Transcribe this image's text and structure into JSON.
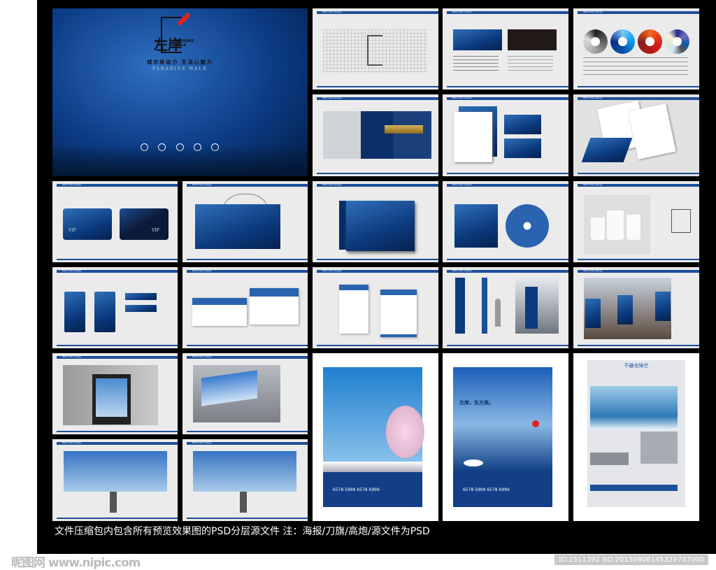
{
  "cover": {
    "logo_cn": "左岸",
    "logo_en_1": "PARADISE",
    "logo_en_2": "WALK",
    "slogan": "城市核动力  生活心魅力",
    "subtitle": "PARADISE WALK"
  },
  "page_header": "HEZ Urban Design",
  "cards": {
    "vip": "VIP"
  },
  "posters": [
    {
      "phone": "6578 5999  6578 6999"
    },
    {
      "headline": "左岸，东方美。",
      "phone": "6578 5999  6578 6999"
    },
    {
      "headline": "不器也锋芒"
    }
  ],
  "caption": "文件压缩包内包含所有预览效果图的PSD分层源文件 注：海报/刀旗/高炮/源文件为PSD",
  "watermark": {
    "site": "昵图网 www.nipic.com",
    "id": "ID:1511392 NO:20150806145329797000"
  },
  "colors": {
    "brand_blue": "#1d4f9a",
    "accent_red": "#e0241b",
    "board": "#000000"
  }
}
